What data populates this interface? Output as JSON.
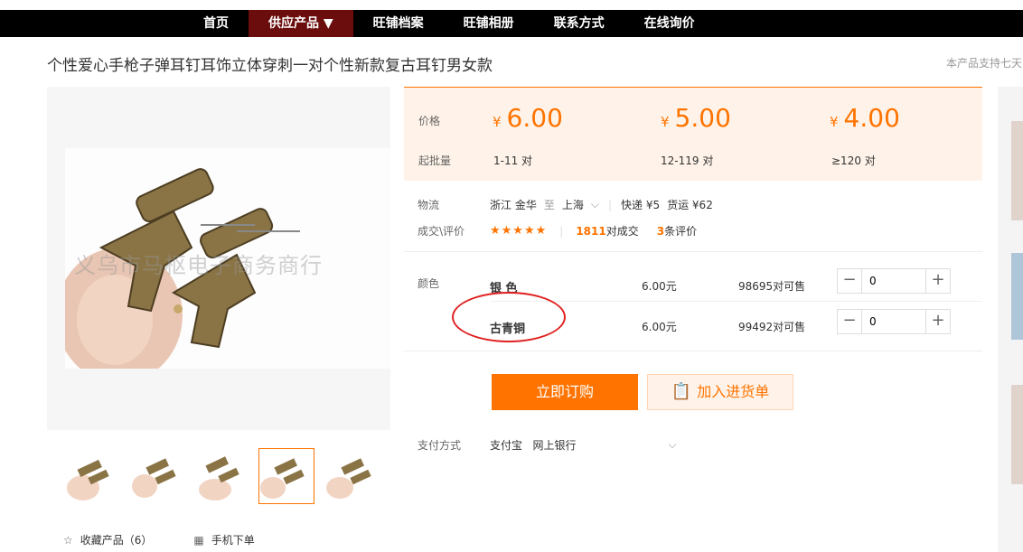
{
  "nav": {
    "items": [
      "首页",
      "供应产品 ▼",
      "旺铺档案",
      "旺铺相册",
      "联系方式",
      "在线询价"
    ]
  },
  "product": {
    "title": "个性爱心手枪子弹耳钉耳饰立体穿刺一对个性新款复古耳钉男女款",
    "support_note": "本产品支持七天",
    "watermark": "义乌市马枢电子商务商行"
  },
  "pricing": {
    "price_label": "价格",
    "qty_label": "起批量",
    "yen": "¥",
    "tiers": [
      {
        "price": "6.00",
        "qty": "1-11 对"
      },
      {
        "price": "5.00",
        "qty": "12-119 对"
      },
      {
        "price": "4.00",
        "qty": "≥120 对"
      }
    ]
  },
  "logistics": {
    "label": "物流",
    "from": "浙江 金华",
    "to_word": "至",
    "to": "上海",
    "express": "快递 ¥5",
    "freight": "货运 ¥62"
  },
  "deals": {
    "label": "成交\\评价",
    "stars": "★★★★★",
    "deal_count": "1811",
    "deal_suffix": "对成交",
    "review_count": "3",
    "review_suffix": "条评价"
  },
  "sku": {
    "label": "颜色",
    "rows": [
      {
        "name": "银 色",
        "price": "6.00元",
        "stock": "98695对可售",
        "qty": "0"
      },
      {
        "name": "古青铜",
        "price": "6.00元",
        "stock": "99492对可售",
        "qty": "0"
      }
    ]
  },
  "actions": {
    "buy": "立即订购",
    "cart": "加入进货单"
  },
  "payment": {
    "label": "支付方式",
    "methods": "支付宝   网上银行"
  },
  "favorites": {
    "collect": "收藏产品（6）",
    "mobile": "手机下单"
  },
  "colors": {
    "accent": "#ff7300",
    "nav_active": "#6b0d0d",
    "annotation": "#e02020"
  }
}
